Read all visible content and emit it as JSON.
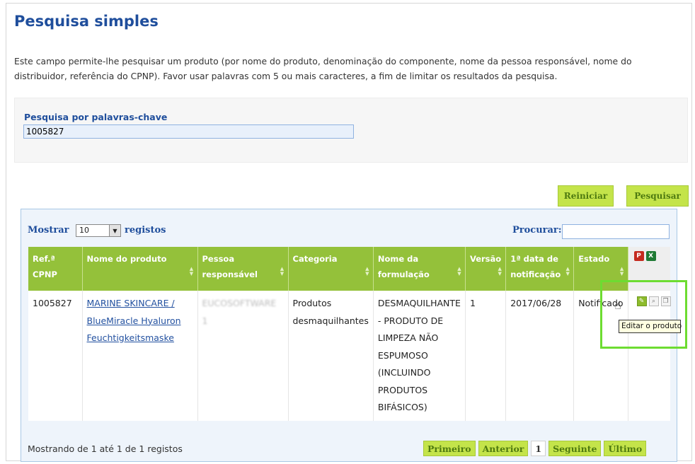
{
  "page": {
    "title": "Pesquisa simples",
    "description": "Este campo permite-lhe pesquisar um produto (por nome do produto, denominação do componente, nome da pessoa responsável, nome do distribuidor, referência do CPNP). Favor usar palavras com 5 ou mais caracteres, a fim de limitar os resultados da pesquisa."
  },
  "search": {
    "label": "Pesquisa por palavras-chave",
    "value": "1005827"
  },
  "buttons": {
    "reset": "Reiniciar",
    "search": "Pesquisar"
  },
  "table_controls": {
    "show_label": "Mostrar",
    "page_length": "10",
    "records_label": "registos",
    "filter_label": "Procurar:",
    "filter_value": ""
  },
  "columns": [
    "Ref.ª CPNP",
    "Nome do produto",
    "Pessoa responsável",
    "Categoria",
    "Nome da formulação",
    "Versão",
    "1ª data de notificação",
    "Estado"
  ],
  "export_icons": [
    "pdf-export-icon",
    "excel-export-icon"
  ],
  "row": {
    "ref": "1005827",
    "product_line1": "MARINE SKINCARE /",
    "product_line2": "BlueMiracle Hyaluron",
    "product_line3": "Feuchtigkeitsmaske",
    "person": "EUCOSOFTWARE 1",
    "category": "Produtos desmaquilhantes",
    "formulation": "DESMAQUILHANTE - PRODUTO DE LIMPEZA NÃO ESPUMOSO (INCLUINDO PRODUTOS BIFÁSICOS)",
    "version": "1",
    "date": "2017/06/28",
    "status": "Notificado"
  },
  "row_actions": [
    "edit-icon",
    "view-icon",
    "copy-icon"
  ],
  "tooltip": "Editar o produto",
  "info": "Mostrando de 1 até 1 de 1 registos",
  "pagination": {
    "first": "Primeiro",
    "previous": "Anterior",
    "current": "1",
    "next": "Seguinte",
    "last": "Último"
  },
  "colors": {
    "heading_blue": "#1f4e9c",
    "header_green": "#94c13a",
    "button_green": "#c4e44a",
    "highlight_green": "#6ddc31"
  }
}
